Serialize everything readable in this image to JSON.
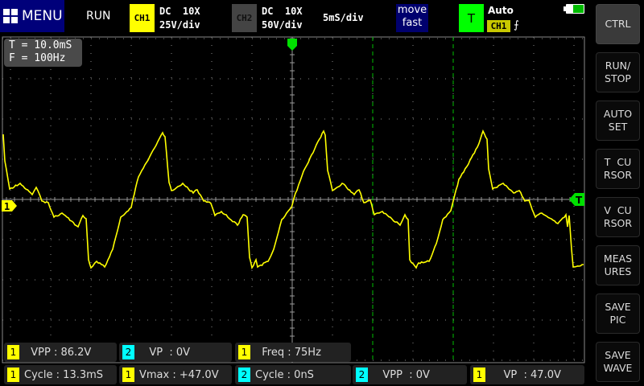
{
  "header": {
    "menu_label": "MENU",
    "run_state": "RUN",
    "ch1": {
      "label": "CH1",
      "coupling": "DC  10X",
      "scale": "25V/div",
      "color": "#ffff00"
    },
    "ch2": {
      "label": "CH2",
      "coupling": "DC  10X",
      "scale": "50V/div",
      "color": "#444444"
    },
    "timebase": "5mS/div",
    "move_mode": [
      "move",
      "fast"
    ],
    "trigger": {
      "label": "T",
      "mode": "Auto",
      "source": "CH1",
      "edge_icon": "rising-edge-icon",
      "edge_glyph": "⨍"
    },
    "battery_level": 0.6
  },
  "info": {
    "period": "T = 10.0mS",
    "freq": "F = 100Hz"
  },
  "markers": {
    "ch1": "1",
    "trigger": "T"
  },
  "buttons": [
    {
      "label": "CTRL",
      "selected": true
    },
    {
      "label": "RUN/\nSTOP"
    },
    {
      "label": "AUTO\nSET"
    },
    {
      "label": "T  CU\nRSOR"
    },
    {
      "label": "V  CU\nRSOR"
    },
    {
      "label": "MEAS\nURES"
    },
    {
      "label": "SAVE\nPIC"
    },
    {
      "label": "SAVE\nWAVE"
    }
  ],
  "measurements": [
    {
      "ch": "1",
      "label": "  VPP : 86.2V"
    },
    {
      "ch": "2",
      "label": "   VP  : 0V"
    },
    {
      "ch": "1",
      "label": "  Freq : 75Hz"
    },
    {
      "ch": "1",
      "label": "Cycle : 13.3mS"
    },
    {
      "ch": "1",
      "label": "Vmax : +47.0V"
    },
    {
      "ch": "2",
      "label": "Cycle : 0nS"
    },
    {
      "ch": "2",
      "label": "   VPP  : 0V"
    },
    {
      "ch": "1",
      "label": "    VP  : 47.0V"
    }
  ],
  "chart_data": {
    "type": "line",
    "xlabel": "",
    "ylabel": "",
    "x_unit": "ms",
    "y_unit": "V",
    "x_per_div": 5,
    "y_per_div": 25,
    "grid": true,
    "cursors_ms": [
      10,
      20
    ],
    "series": [
      {
        "color": "#ffff00",
        "points": [
          [
            -35.9,
            40.5
          ],
          [
            -35.7,
            24
          ],
          [
            -35.1,
            6.5
          ],
          [
            -33.8,
            10
          ],
          [
            -32.3,
            3
          ],
          [
            -31.8,
            7.5
          ],
          [
            -31.1,
            -1
          ],
          [
            -30.3,
            -2
          ],
          [
            -29.6,
            -11
          ],
          [
            -28.6,
            -8.5
          ],
          [
            -26.6,
            -17
          ],
          [
            -26.0,
            -10
          ],
          [
            -25.6,
            -12
          ],
          [
            -25.3,
            -37.5
          ],
          [
            -25.0,
            -42.5
          ],
          [
            -24.3,
            -38.5
          ],
          [
            -23.3,
            -42
          ],
          [
            -22.3,
            -31
          ],
          [
            -21.3,
            -11
          ],
          [
            -20.0,
            -5
          ],
          [
            -19.8,
            0
          ],
          [
            -19.1,
            14
          ],
          [
            -17.3,
            30.5
          ],
          [
            -16.1,
            41.5
          ],
          [
            -15.8,
            39
          ],
          [
            -15.3,
            10.5
          ],
          [
            -15.0,
            5.5
          ],
          [
            -13.6,
            10
          ],
          [
            -12.3,
            4
          ],
          [
            -11.8,
            6
          ],
          [
            -11.0,
            -1
          ],
          [
            -10.1,
            -2.5
          ],
          [
            -9.6,
            -10
          ],
          [
            -8.8,
            -7.5
          ],
          [
            -6.8,
            -16
          ],
          [
            -6.1,
            -9.5
          ],
          [
            -5.6,
            -11
          ],
          [
            -5.3,
            -36
          ],
          [
            -5.0,
            -42.5
          ],
          [
            -4.5,
            -37.5
          ],
          [
            -4.3,
            -42
          ],
          [
            -3.0,
            -38.5
          ],
          [
            -2.3,
            -31
          ],
          [
            -1.3,
            -12.5
          ],
          [
            -0.1,
            -5
          ],
          [
            0.2,
            0.5
          ],
          [
            1.4,
            17.5
          ],
          [
            2.0,
            23
          ],
          [
            3.0,
            34
          ],
          [
            3.9,
            42.5
          ],
          [
            4.1,
            40
          ],
          [
            4.4,
            18
          ],
          [
            5.0,
            5.5
          ],
          [
            6.2,
            10
          ],
          [
            7.7,
            3
          ],
          [
            8.3,
            6
          ],
          [
            8.9,
            -2
          ],
          [
            9.7,
            -0.5
          ],
          [
            10.2,
            -9.5
          ],
          [
            11.2,
            -7.5
          ],
          [
            13.4,
            -16
          ],
          [
            14.0,
            -9.5
          ],
          [
            14.4,
            -12.5
          ],
          [
            14.6,
            -37.5
          ],
          [
            15.4,
            -42.5
          ],
          [
            15.7,
            -39.5
          ],
          [
            17.0,
            -38.5
          ],
          [
            17.9,
            -27.5
          ],
          [
            18.7,
            -12.5
          ],
          [
            19.7,
            -7
          ],
          [
            20.0,
            -1
          ],
          [
            20.7,
            12.5
          ],
          [
            21.7,
            20.5
          ],
          [
            23.0,
            32.5
          ],
          [
            23.7,
            42.5
          ],
          [
            24.2,
            37.5
          ],
          [
            24.4,
            19
          ],
          [
            24.9,
            6.5
          ],
          [
            26.2,
            10
          ],
          [
            27.5,
            4
          ],
          [
            28.2,
            5.5
          ],
          [
            28.9,
            -1
          ],
          [
            29.4,
            -0.5
          ],
          [
            30.2,
            -11
          ],
          [
            31.0,
            -8.5
          ],
          [
            33.0,
            -15
          ],
          [
            34.0,
            -9.5
          ],
          [
            34.2,
            -17
          ],
          [
            34.4,
            -10
          ],
          [
            34.7,
            -31
          ],
          [
            34.9,
            -42
          ],
          [
            36.2,
            -40.5
          ]
        ]
      }
    ]
  }
}
